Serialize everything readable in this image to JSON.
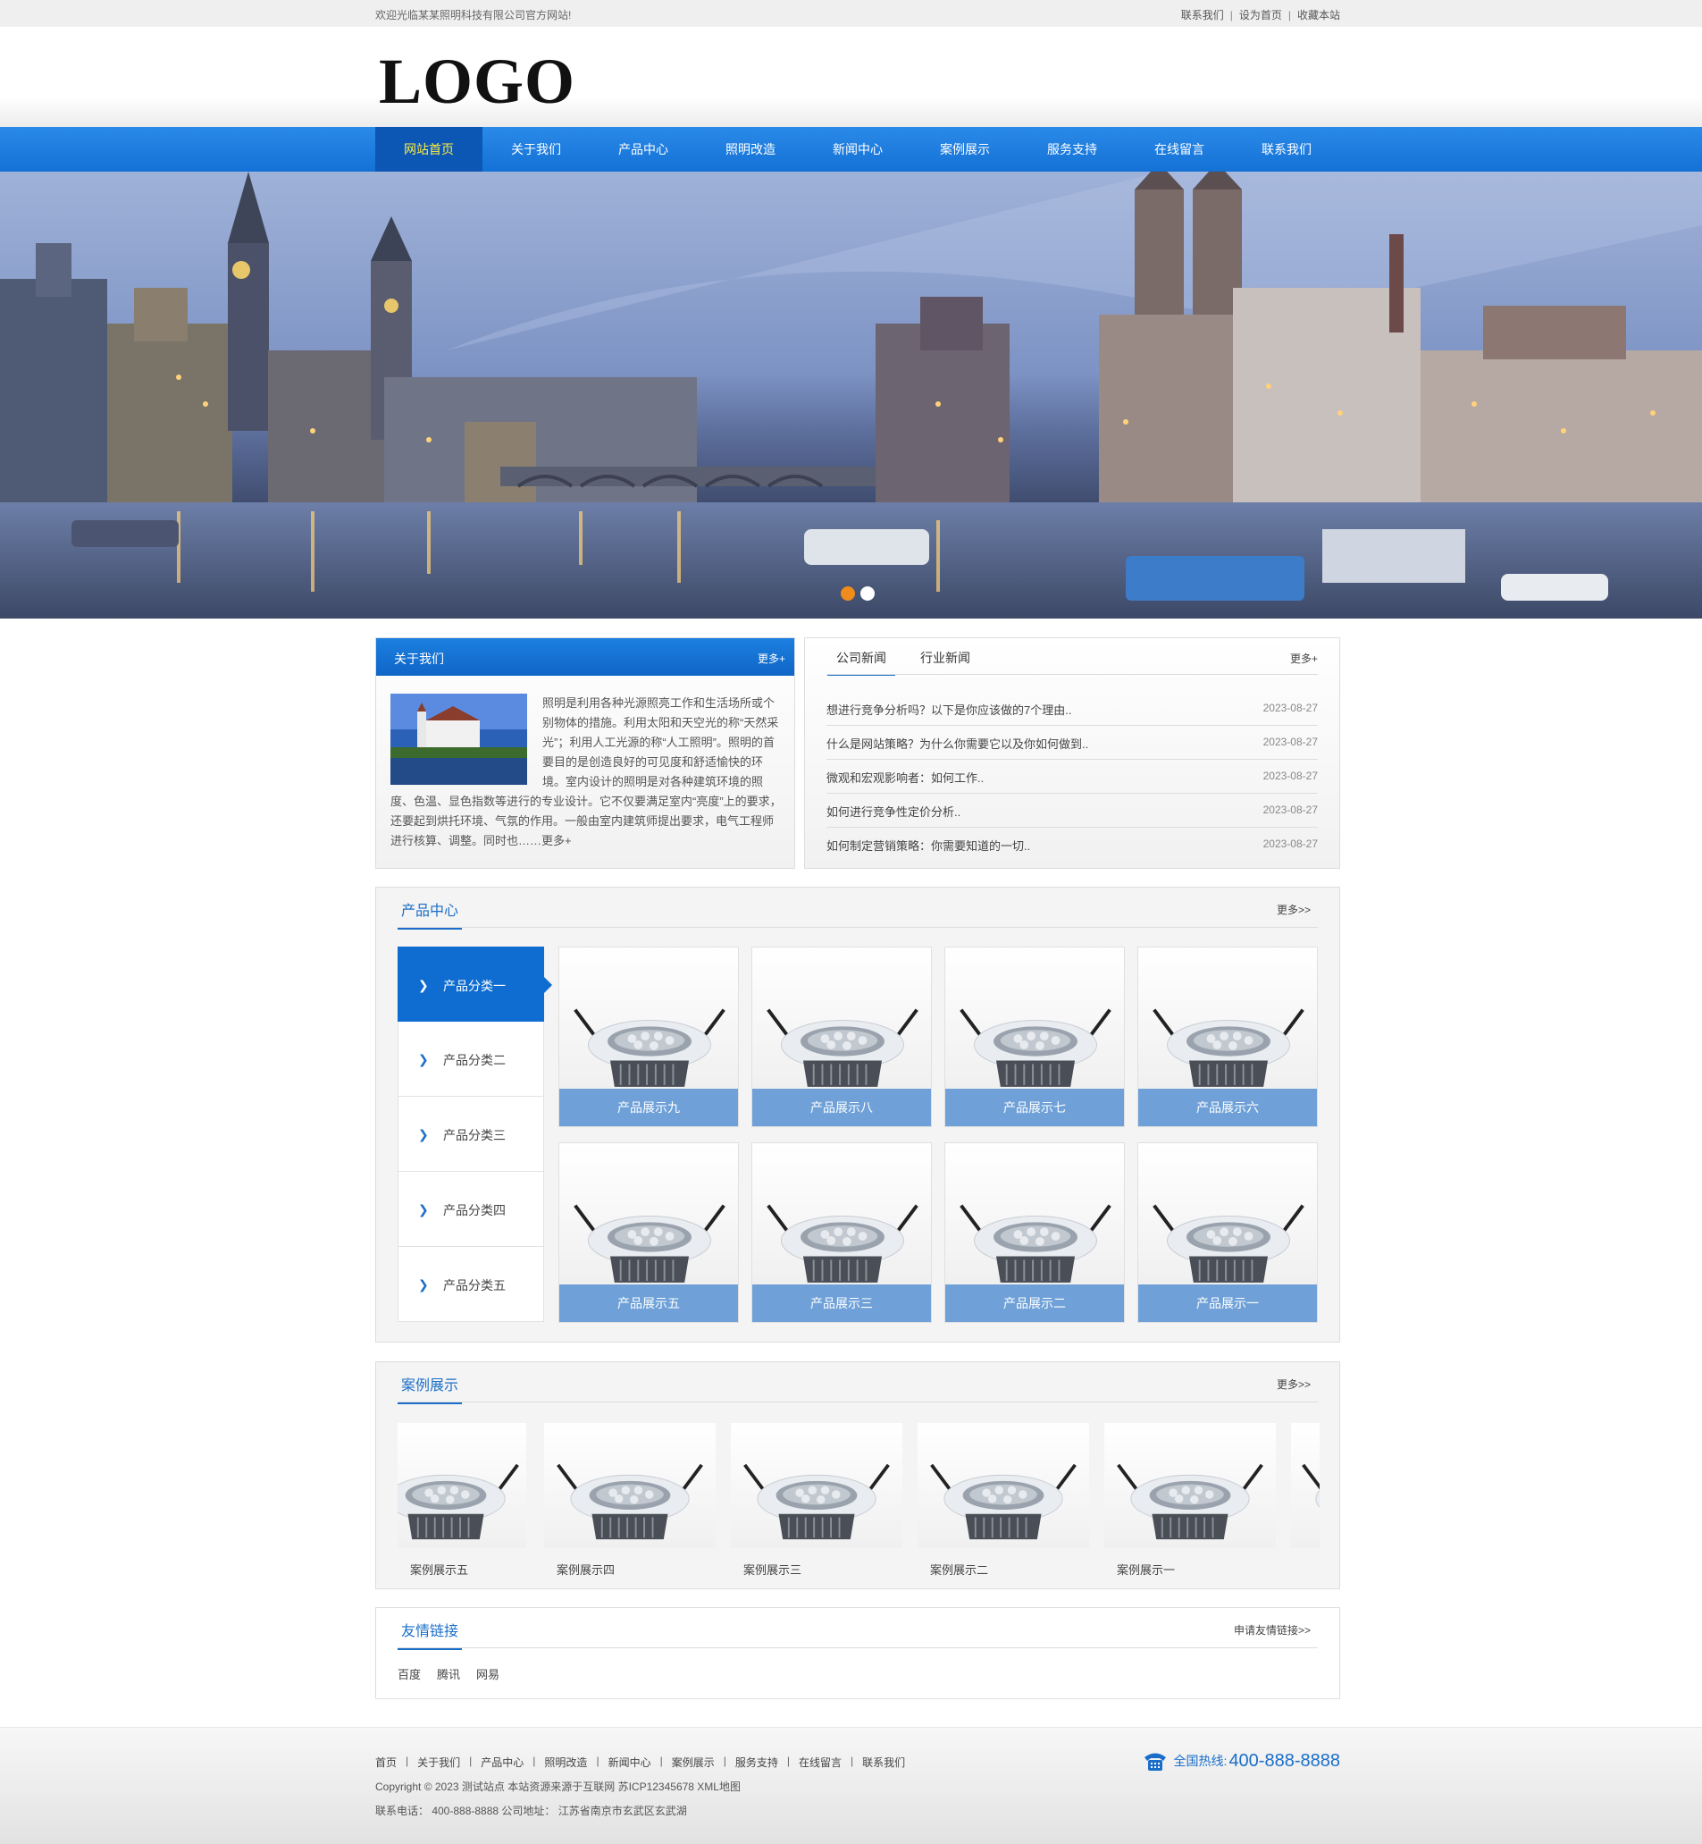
{
  "topbar": {
    "welcome": "欢迎光临某某照明科技有限公司官方网站!",
    "links": [
      "联系我们",
      "设为首页",
      "收藏本站"
    ]
  },
  "header": {
    "logo": "LOGO"
  },
  "nav": [
    "网站首页",
    "关于我们",
    "产品中心",
    "照明改造",
    "新闻中心",
    "案例展示",
    "服务支持",
    "在线留言",
    "联系我们"
  ],
  "about": {
    "title": "关于我们",
    "more": "更多+",
    "text": "照明是利用各种光源照亮工作和生活场所或个别物体的措施。利用太阳和天空光的称“天然采光”；利用人工光源的称“人工照明”。照明的首要目的是创造良好的可见度和舒适愉快的环境。室内设计的照明是对各种建筑环境的照度、色温、显色指数等进行的专业设计。它不仅要满足室内“亮度”上的要求，还要起到烘托环境、气氛的作用。一般由室内建筑师提出要求，电气工程师进行核算、调整。同时也……",
    "text_more": "更多+"
  },
  "news": {
    "tabs": [
      "公司新闻",
      "行业新闻"
    ],
    "more": "更多+",
    "items": [
      {
        "title": "想进行竞争分析吗？以下是你应该做的7个理由..",
        "date": "2023-08-27"
      },
      {
        "title": "什么是网站策略？为什么你需要它以及你如何做到..",
        "date": "2023-08-27"
      },
      {
        "title": "微观和宏观影响者：如何工作..",
        "date": "2023-08-27"
      },
      {
        "title": "如何进行竞争性定价分析..",
        "date": "2023-08-27"
      },
      {
        "title": "如何制定营销策略：你需要知道的一切..",
        "date": "2023-08-27"
      }
    ]
  },
  "products": {
    "title": "产品中心",
    "more": "更多>>",
    "categories": [
      "产品分类一",
      "产品分类二",
      "产品分类三",
      "产品分类四",
      "产品分类五"
    ],
    "items": [
      "产品展示九",
      "产品展示八",
      "产品展示七",
      "产品展示六",
      "产品展示五",
      "产品展示三",
      "产品展示二",
      "产品展示一"
    ]
  },
  "cases": {
    "title": "案例展示",
    "more": "更多>>",
    "items": [
      "案例展示五",
      "案例展示四",
      "案例展示三",
      "案例展示二",
      "案例展示一"
    ]
  },
  "friends": {
    "title": "友情链接",
    "apply": "申请友情链接>>",
    "links": [
      "百度",
      "腾讯",
      "网易"
    ]
  },
  "footer": {
    "nav": [
      "首页",
      "关于我们",
      "产品中心",
      "照明改造",
      "新闻中心",
      "案例展示",
      "服务支持",
      "在线留言",
      "联系我们"
    ],
    "copyright": "Copyright © 2023 测试站点 本站资源来源于互联网 苏ICP12345678 XML地图",
    "contact": "联系电话： 400-888-8888 公司地址： 江苏省南京市玄武区玄武湖",
    "hotline_label": "全国热线:",
    "hotline": "400-888-8888"
  },
  "colors": {
    "nav": "#1471d6",
    "accent": "#1a6ec9",
    "caption": "#6fa1d8",
    "active_nav_text": "#ffee44"
  }
}
